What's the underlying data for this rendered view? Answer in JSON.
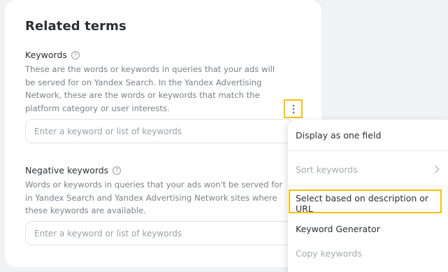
{
  "section": {
    "title": "Related terms",
    "keywords": {
      "label": "Keywords",
      "description": "These are the words or keywords in queries that your ads will be served for on Yandex Search. In the Yandex Advertising Network, these are the words or keywords that match the platform category or user interests.",
      "description_lines": [
        "These are the words or keywords in queries that your ads will",
        "be served for on Yandex Search. In the Yandex Advertising",
        "Network, these are the words or keywords that match the",
        "platform category or user interests."
      ],
      "placeholder": "Enter a keyword or list of keywords"
    },
    "negative_keywords": {
      "label": "Negative keywords",
      "description_lines": [
        "Words or keywords in queries that your ads won't be served for",
        "in Yandex Search and Yandex Advertising Network sites where",
        "these keywords are available."
      ],
      "placeholder": "Enter a keyword or list of keywords"
    },
    "help_icon_glyph": "?"
  },
  "menu": {
    "items": [
      {
        "label": "Display as one field",
        "disabled": false
      },
      {
        "label": "Sort keywords",
        "disabled": true,
        "has_submenu": true
      },
      {
        "label": "Select based on description or URL",
        "disabled": false,
        "highlighted": true
      },
      {
        "label": "Keyword Generator",
        "disabled": false
      },
      {
        "label": "Copy keywords",
        "disabled": true
      }
    ]
  },
  "colors": {
    "highlight": "#f2c200",
    "text_primary": "#2b2f36",
    "text_secondary": "#7b8089",
    "text_disabled": "#a6abb2"
  }
}
